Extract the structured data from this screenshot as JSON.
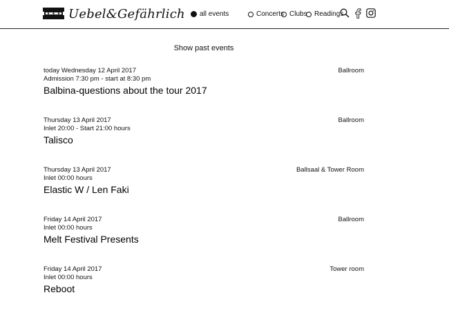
{
  "header": {
    "logo_text": "Uebel&Gefährlich",
    "logo_icon": "razor-blade-icon",
    "nav": {
      "all_events": "all events",
      "concerts": "Concerts",
      "clubs": "Clubs",
      "readings": "Readings",
      "selected": "all events"
    },
    "icons": [
      "search-icon",
      "facebook-icon",
      "instagram-icon"
    ]
  },
  "show_past_label": "Show past events",
  "events": [
    {
      "date": "today Wednesday 12 April 2017",
      "admission": "Admission 7:30 pm - start at 8:30 pm",
      "title": "Balbina-questions about the tour 2017",
      "venue": "Ballroom"
    },
    {
      "date": "Thursday 13 April 2017",
      "admission": "Inlet 20:00 - Start 21:00 hours",
      "title": "Talisco",
      "venue": "Ballroom"
    },
    {
      "date": "Thursday 13 April 2017",
      "admission": "Inlet 00:00 hours",
      "title": "Elastic W / Len Faki",
      "venue": "Ballsaal & Tower Room"
    },
    {
      "date": "Friday 14 April 2017",
      "admission": "Inlet 00:00 hours",
      "title": "Melt Festival Presents",
      "venue": "Ballroom"
    },
    {
      "date": "Friday 14 April 2017",
      "admission": "Inlet 00:00 hours",
      "title": "Reboot",
      "venue": "Tower room"
    }
  ]
}
